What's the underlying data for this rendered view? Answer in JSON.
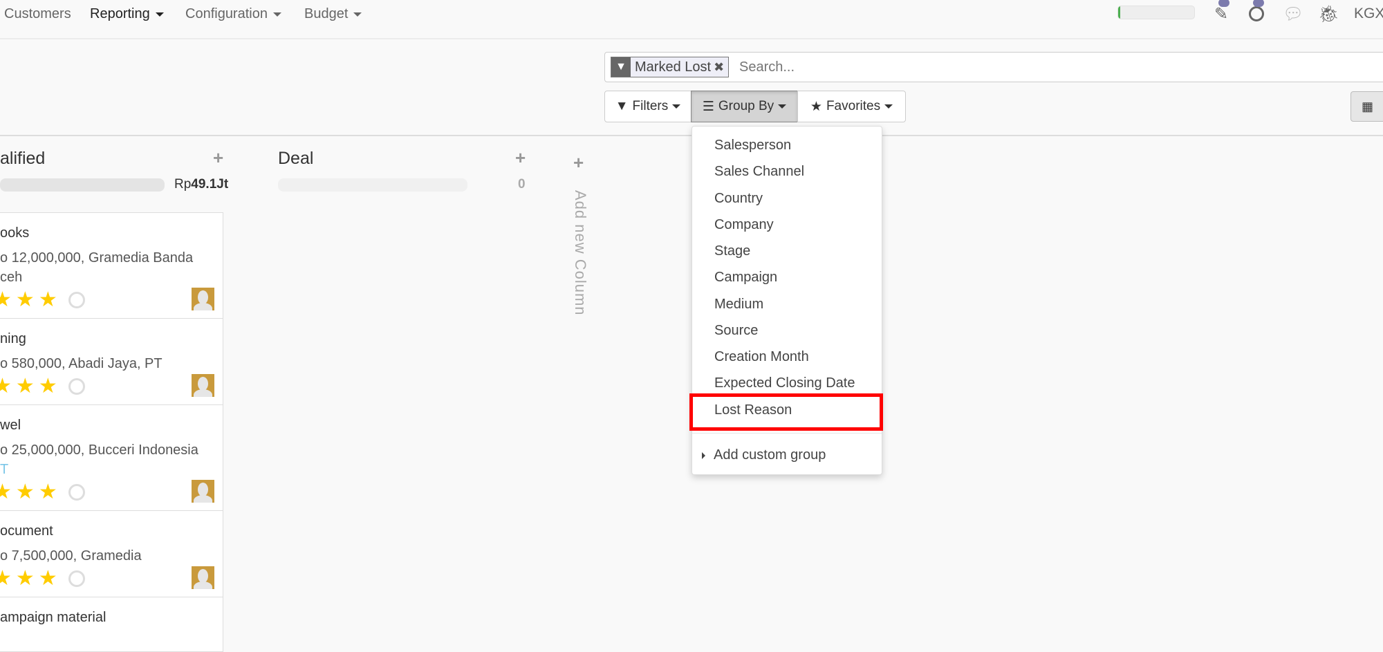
{
  "nav": {
    "items": [
      {
        "label": "Customers",
        "dropdown": false
      },
      {
        "label": "Reporting",
        "dropdown": true,
        "active": true
      },
      {
        "label": "Configuration",
        "dropdown": true
      },
      {
        "label": "Budget",
        "dropdown": true
      }
    ],
    "progress_percent": 3,
    "progress_color": "#4caf50",
    "icons": [
      "edit-icon",
      "clock-icon",
      "chat-icon",
      "bug-icon"
    ],
    "user": "KGX"
  },
  "search": {
    "facet_label": "Marked Lost",
    "placeholder": "Search..."
  },
  "toolbar": {
    "filters": "Filters",
    "group_by": "Group By",
    "favorites": "Favorites"
  },
  "group_by_menu": {
    "items": [
      "Salesperson",
      "Sales Channel",
      "Country",
      "Company",
      "Stage",
      "Campaign",
      "Medium",
      "Source",
      "Creation Month",
      "Expected Closing Date",
      "Lost Reason"
    ],
    "highlighted": "Lost Reason",
    "highlight_color": "#ff0000",
    "custom": "Add custom group"
  },
  "columns": [
    {
      "title": "alified",
      "total_prefix": "Rp",
      "total": "49.1Jt"
    },
    {
      "title": "Deal",
      "total": "0"
    }
  ],
  "add_column": "Add new Column",
  "cards": [
    {
      "title": "ooks",
      "lines": [
        "o 12,000,000, Gramedia Banda",
        "ceh"
      ]
    },
    {
      "title": "ning",
      "lines": [
        "o 580,000, Abadi Jaya, PT"
      ]
    },
    {
      "title": "wel",
      "lines": [
        "o 25,000,000, Bucceri Indonesia",
        "T"
      ]
    },
    {
      "title": "ocument",
      "lines": [
        "o 7,500,000, Gramedia"
      ]
    },
    {
      "title": "ampaign material",
      "lines": []
    }
  ]
}
